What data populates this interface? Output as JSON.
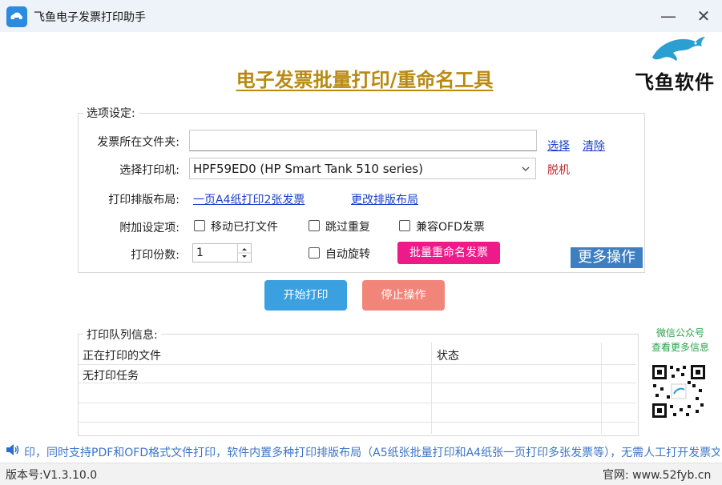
{
  "window": {
    "title": "飞鱼电子发票打印助手",
    "minimize_glyph": "—",
    "close_glyph": "✕"
  },
  "header": {
    "main_title": "电子发票批量打印/重命名工具",
    "logo_text": "飞鱼软件"
  },
  "options": {
    "group_title": "选项设定:",
    "folder_label": "发票所在文件夹:",
    "folder_value": "",
    "select_link": "选择",
    "clear_link": "清除",
    "printer_label": "选择打印机:",
    "printer_value": "HPF59ED0 (HP Smart Tank 510 series)",
    "printer_status": "脱机",
    "layout_label": "打印排版布局:",
    "layout_value_link": "一页A4纸打印2张发票",
    "change_layout_link": "更改排版布局",
    "extra_label": "附加设定项:",
    "cb_move_printed": "移动已打文件",
    "cb_skip_duplicate": "跳过重复",
    "cb_ofd": "兼容OFD发票",
    "copies_label": "打印份数:",
    "copies_value": "1",
    "cb_auto_rotate": "自动旋转",
    "batch_rename_button": "批量重命名发票",
    "more_ops_button": "更多操作"
  },
  "actions": {
    "start_print": "开始打印",
    "stop": "停止操作"
  },
  "queue": {
    "group_title": "打印队列信息:",
    "columns": [
      "正在打印的文件",
      "状态"
    ],
    "rows": [
      [
        "无打印任务",
        ""
      ]
    ]
  },
  "side": {
    "wechat_line1": "微信公众号",
    "wechat_line2": "查看更多信息"
  },
  "marquee": {
    "text": "印，同时支持PDF和OFD格式文件打印，软件内置多种打印排版布局（A5纸张批量打印和A4纸张一页打印多张发票等），无需人工打开发票文"
  },
  "statusbar": {
    "version": "版本号:V1.3.10.0",
    "website": "官网:  www.52fyb.cn"
  },
  "colors": {
    "title_gold": "#b98a12",
    "link_blue": "#1a3ec8",
    "start_btn": "#3aa0e0",
    "stop_btn": "#f2857a",
    "rename_btn": "#ee1a8a",
    "more_btn": "#3d7fc2",
    "offline_red": "#b92828",
    "wechat_green": "#2aa14a"
  }
}
